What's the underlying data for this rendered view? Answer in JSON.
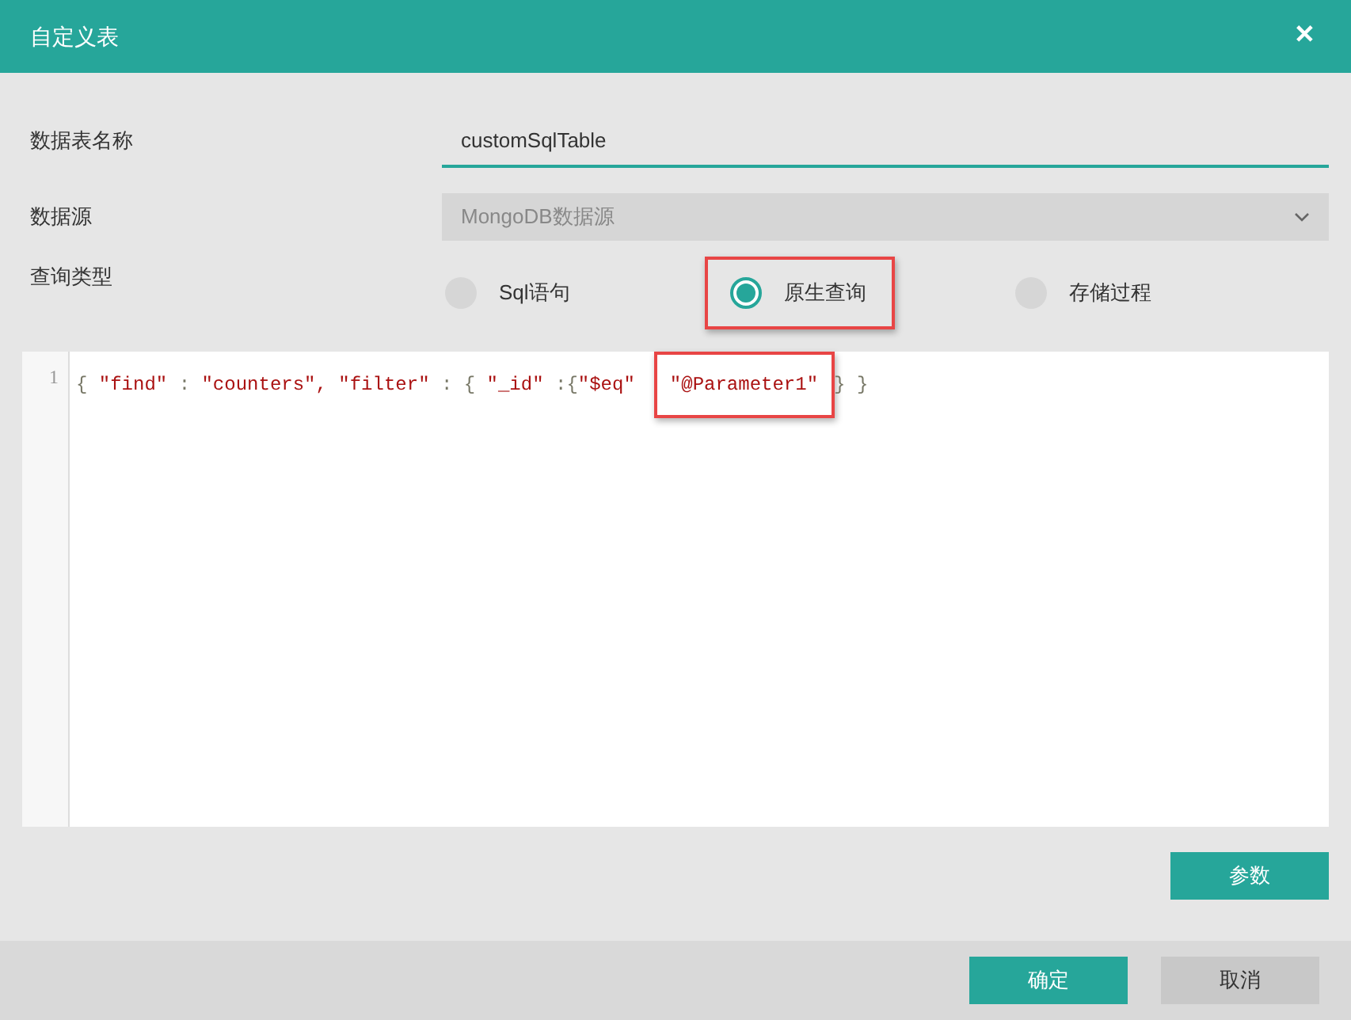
{
  "dialog": {
    "title": "自定义表",
    "close": "✕"
  },
  "fields": {
    "table_name": {
      "label": "数据表名称",
      "value": "customSqlTable"
    },
    "data_source": {
      "label": "数据源",
      "value": "MongoDB数据源",
      "disabled": true
    },
    "query_type": {
      "label": "查询类型",
      "options": [
        {
          "label": "Sql语句",
          "selected": false,
          "highlighted": false
        },
        {
          "label": "原生查询",
          "selected": true,
          "highlighted": true
        },
        {
          "label": "存储过程",
          "selected": false,
          "highlighted": false
        }
      ]
    }
  },
  "editor": {
    "line_number": "1",
    "tokens": [
      {
        "kind": "punct",
        "text": "{ ",
        "highlighted": false
      },
      {
        "kind": "string",
        "text": "\"find\"",
        "highlighted": false
      },
      {
        "kind": "punct",
        "text": " : ",
        "highlighted": false
      },
      {
        "kind": "string",
        "text": "\"counters\",",
        "highlighted": false
      },
      {
        "kind": "string",
        "text": " \"filter\"",
        "highlighted": false
      },
      {
        "kind": "punct",
        "text": " : { ",
        "highlighted": false
      },
      {
        "kind": "string",
        "text": "\"_id\"",
        "highlighted": false
      },
      {
        "kind": "punct",
        "text": " :{",
        "highlighted": false
      },
      {
        "kind": "string",
        "text": "\"$eq\"",
        "highlighted": false
      },
      {
        "kind": "string",
        "text": "\"@Parameter1\"",
        "highlighted": true
      },
      {
        "kind": "punct",
        "text": "} }",
        "highlighted": false
      }
    ]
  },
  "params_button": "参数",
  "footer": {
    "confirm": "确定",
    "cancel": "取消"
  }
}
